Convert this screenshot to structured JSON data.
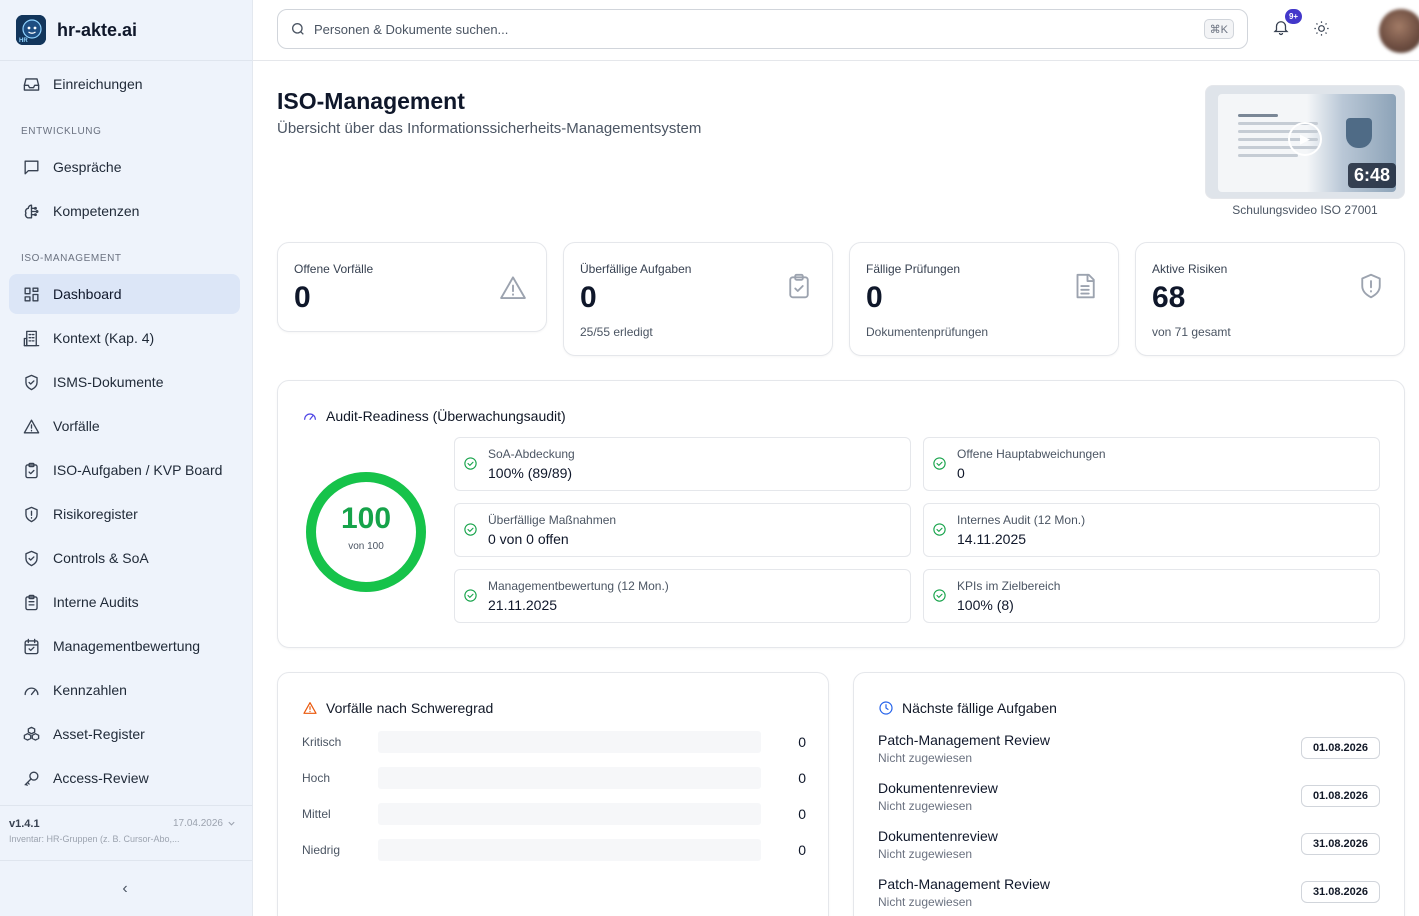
{
  "app": {
    "name": "hr-akte.ai",
    "logo_text": "HR"
  },
  "sidebar": {
    "top_item": {
      "label": "Einreichungen",
      "icon": "inbox-icon"
    },
    "section_dev": "ENTWICKLUNG",
    "dev_items": [
      {
        "label": "Gespräche",
        "icon": "chat-icon"
      },
      {
        "label": "Kompetenzen",
        "icon": "brain-icon"
      }
    ],
    "section_iso": "ISO-MANAGEMENT",
    "iso_items": [
      {
        "label": "Dashboard",
        "icon": "dashboard-icon",
        "active": true
      },
      {
        "label": "Kontext (Kap. 4)",
        "icon": "building-icon"
      },
      {
        "label": "ISMS-Dokumente",
        "icon": "shield-check-icon"
      },
      {
        "label": "Vorfälle",
        "icon": "warning-icon"
      },
      {
        "label": "ISO-Aufgaben / KVP Board",
        "icon": "clipboard-check-icon"
      },
      {
        "label": "Risikoregister",
        "icon": "shield-alert-icon"
      },
      {
        "label": "Controls & SoA",
        "icon": "shield-check-icon"
      },
      {
        "label": "Interne Audits",
        "icon": "clipboard-list-icon"
      },
      {
        "label": "Managementbewertung",
        "icon": "calendar-check-icon"
      },
      {
        "label": "Kennzahlen",
        "icon": "gauge-icon"
      },
      {
        "label": "Asset-Register",
        "icon": "boxes-icon"
      },
      {
        "label": "Access-Review",
        "icon": "key-icon"
      }
    ],
    "footer": {
      "version": "v1.4.1",
      "date": "17.04.2026",
      "note": "Inventar: HR-Gruppen (z. B. Cursor-Abo,..."
    },
    "collapse_glyph": "‹"
  },
  "header": {
    "search_placeholder": "Personen & Dokumente suchen...",
    "shortcut": "⌘K",
    "notification_badge": "9+"
  },
  "page": {
    "title": "ISO-Management",
    "subtitle": "Übersicht über das Informationssicherheits-Managementsystem",
    "video": {
      "duration": "6:48",
      "caption": "Schulungsvideo ISO 27001"
    }
  },
  "kpis": [
    {
      "label": "Offene Vorfälle",
      "value": "0",
      "sub": "",
      "icon": "warning-icon"
    },
    {
      "label": "Überfällige Aufgaben",
      "value": "0",
      "sub": "25/55 erledigt",
      "icon": "clipboard-check-icon"
    },
    {
      "label": "Fällige Prüfungen",
      "value": "0",
      "sub": "Dokumentenprüfungen",
      "icon": "document-icon"
    },
    {
      "label": "Aktive Risiken",
      "value": "68",
      "sub": "von 71 gesamt",
      "icon": "shield-alert-icon"
    }
  ],
  "audit": {
    "title": "Audit-Readiness (Überwachungsaudit)",
    "score": "100",
    "score_sub": "von 100",
    "score_fraction": 1.0,
    "ring_color": "#16c34a",
    "checks": [
      {
        "label": "SoA-Abdeckung",
        "value": "100% (89/89)"
      },
      {
        "label": "Offene Hauptabweichungen",
        "value": "0"
      },
      {
        "label": "Überfällige Maßnahmen",
        "value": "0 von 0 offen"
      },
      {
        "label": "Internes Audit (12 Mon.)",
        "value": "14.11.2025"
      },
      {
        "label": "Managementbewertung (12 Mon.)",
        "value": "21.11.2025"
      },
      {
        "label": "KPIs im Zielbereich",
        "value": "100% (8)"
      }
    ]
  },
  "severity": {
    "title": "Vorfälle nach Schweregrad",
    "rows": [
      {
        "label": "Kritisch",
        "count": "0",
        "fraction": 0
      },
      {
        "label": "Hoch",
        "count": "0",
        "fraction": 0
      },
      {
        "label": "Mittel",
        "count": "0",
        "fraction": 0
      },
      {
        "label": "Niedrig",
        "count": "0",
        "fraction": 0
      }
    ]
  },
  "tasks": {
    "title": "Nächste fällige Aufgaben",
    "items": [
      {
        "title": "Patch-Management Review",
        "assignee": "Nicht zugewiesen",
        "date": "01.08.2026"
      },
      {
        "title": "Dokumentenreview",
        "assignee": "Nicht zugewiesen",
        "date": "01.08.2026"
      },
      {
        "title": "Dokumentenreview",
        "assignee": "Nicht zugewiesen",
        "date": "31.08.2026"
      },
      {
        "title": "Patch-Management Review",
        "assignee": "Nicht zugewiesen",
        "date": "31.08.2026"
      }
    ]
  }
}
